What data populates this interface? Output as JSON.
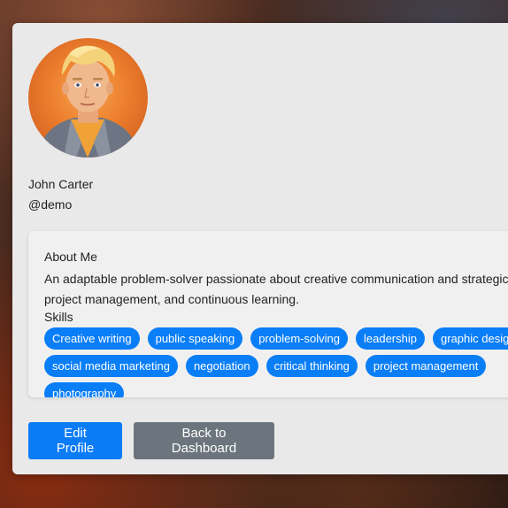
{
  "profile": {
    "name": "John Carter",
    "username": "@demo"
  },
  "about": {
    "title": "About Me",
    "text": "An adaptable problem-solver passionate about creative communication and strategic project management, and continuous learning."
  },
  "skills": {
    "title": "Skills",
    "items": [
      "Creative writing",
      "public speaking",
      "problem-solving",
      "leadership",
      "graphic design",
      "social media marketing",
      "negotiation",
      "critical thinking",
      "project management",
      "photography"
    ]
  },
  "actions": {
    "edit_label": "Edit Profile",
    "back_label": "Back to Dashboard"
  },
  "colors": {
    "primary": "#0b7cf6",
    "secondary": "#6c757d",
    "tag": "#0a7ef7"
  }
}
